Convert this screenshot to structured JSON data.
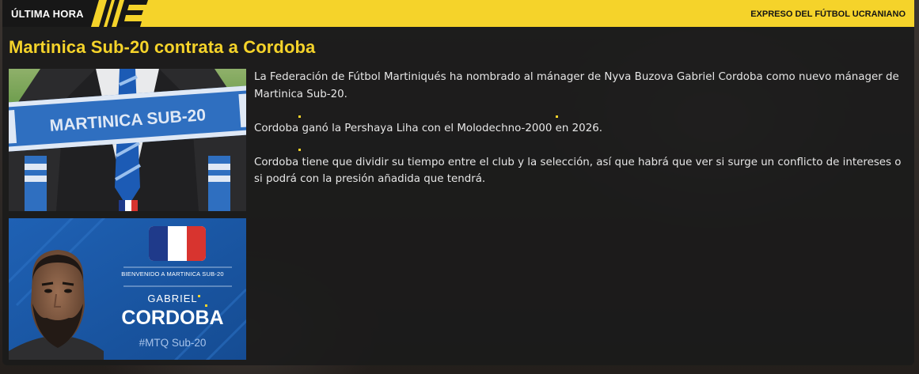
{
  "breaking_tag": "ÚLTIMA HORA",
  "source": "EXPRESO DEL FÚTBOL UCRANIANO",
  "headline": "Martinica Sub-20 contrata a Cordoba",
  "paragraphs": [
    "La Federación de Fútbol Martiniqués ha nombrado al mánager de Nyva Buzova Gabriel Cordoba como nuevo mánager de Martinica Sub-20.",
    "Cordoba ganó la Pershaya Liha con el Molodechno-2000 en 2026.",
    "Cordoba tiene que dividir su tiempo entre el club y la selección, así que habrá que ver si surge un conflicto de intereses o si podrá con la presión añadida que tendrá."
  ],
  "scarf_text": "MARTINICA SUB-20",
  "welcome_card": {
    "label": "BIENVENIDO A MARTINICA SUB-20",
    "first_name": "GABRIEL",
    "last_name": "CORDOBA",
    "hashtag": "#MTQ Sub-20"
  },
  "colors": {
    "accent": "#f5d32a",
    "flag_blue": "#1f3a8a",
    "flag_white": "#ffffff",
    "flag_red": "#d8342f"
  }
}
